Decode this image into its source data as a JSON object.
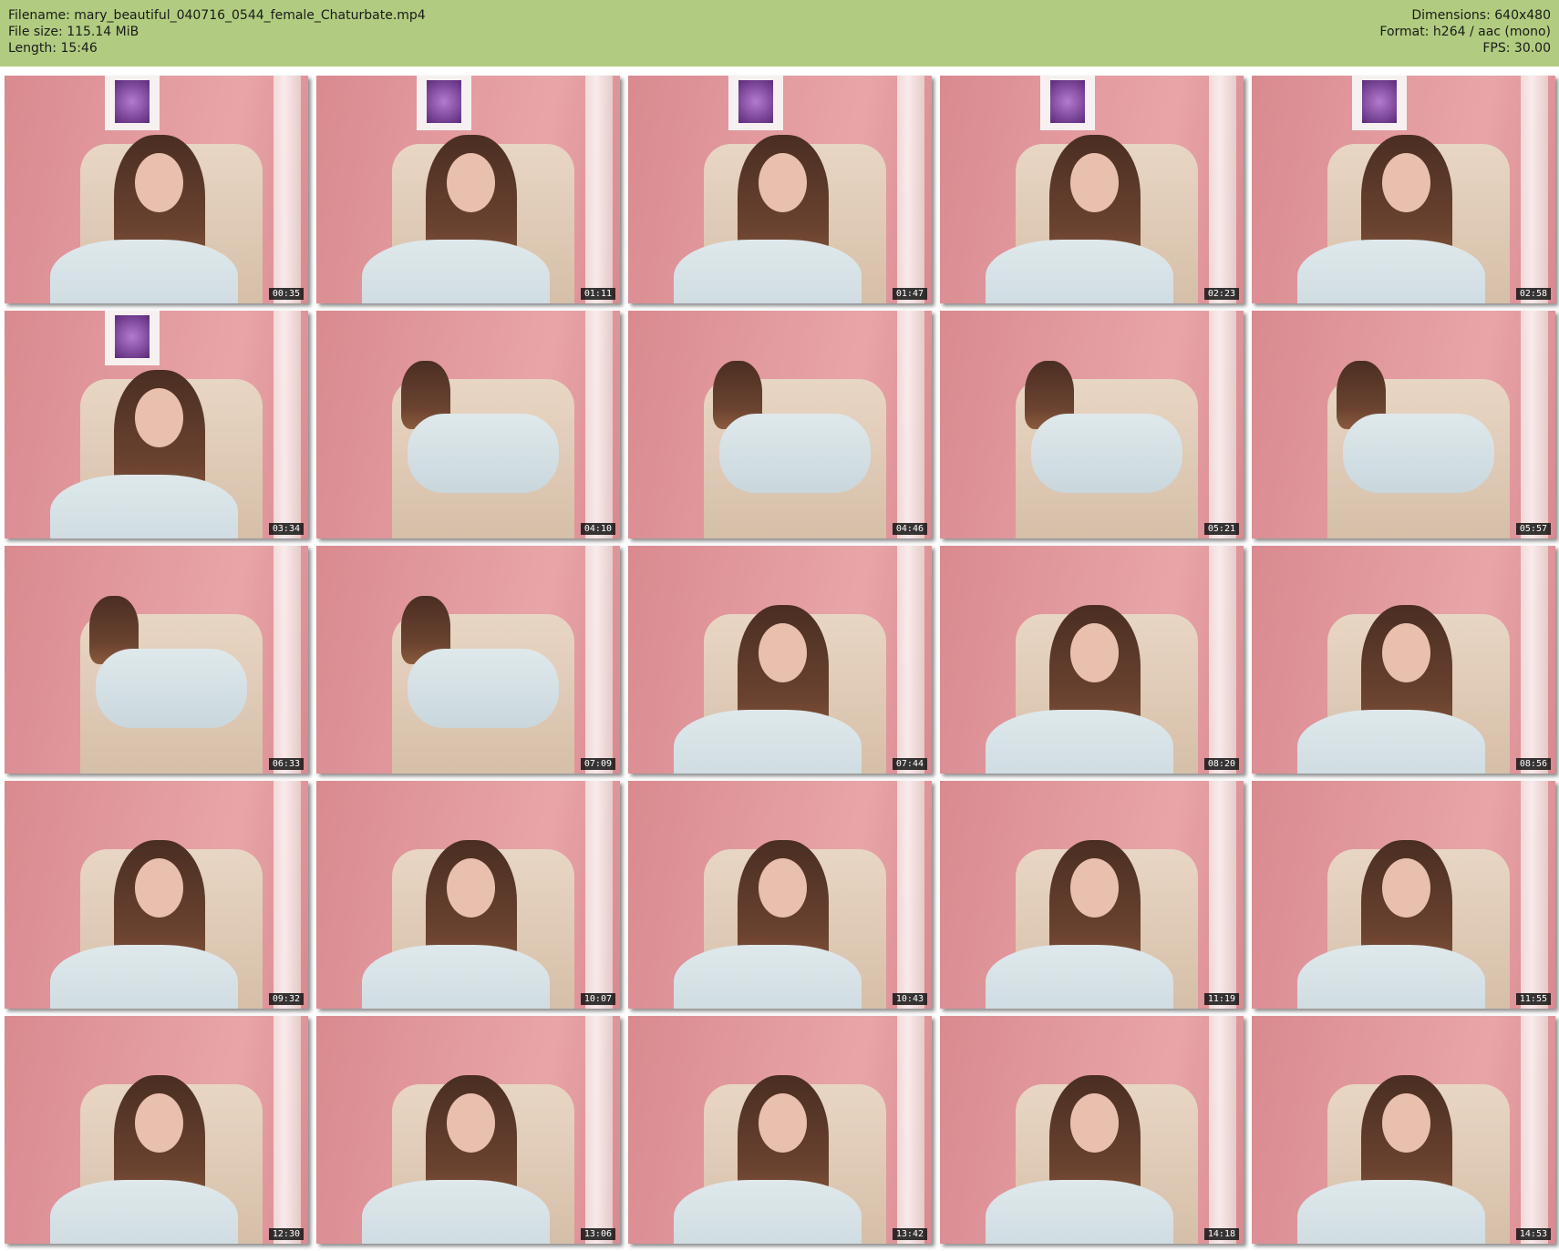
{
  "header": {
    "filename": "Filename: mary_beautiful_040716_0544_female_Chaturbate.mp4",
    "filesize": "File size: 115.14 MiB",
    "length": "Length: 15:46",
    "dimensions": "Dimensions: 640x480",
    "format": "Format: h264 / aac (mono)",
    "fps": "FPS: 30.00"
  },
  "colors": {
    "header_bg": "#b1cc80"
  },
  "thumbnails": [
    {
      "time": "00:35",
      "scene": "chair"
    },
    {
      "time": "01:11",
      "scene": "chair"
    },
    {
      "time": "01:47",
      "scene": "chair"
    },
    {
      "time": "02:23",
      "scene": "chair"
    },
    {
      "time": "02:58",
      "scene": "chair"
    },
    {
      "time": "03:34",
      "scene": "chair"
    },
    {
      "time": "04:10",
      "scene": "couch"
    },
    {
      "time": "04:46",
      "scene": "couch"
    },
    {
      "time": "05:21",
      "scene": "couch"
    },
    {
      "time": "05:57",
      "scene": "couch"
    },
    {
      "time": "06:33",
      "scene": "couch"
    },
    {
      "time": "07:09",
      "scene": "couch"
    },
    {
      "time": "07:44",
      "scene": "close"
    },
    {
      "time": "08:20",
      "scene": "close"
    },
    {
      "time": "08:56",
      "scene": "close"
    },
    {
      "time": "09:32",
      "scene": "close"
    },
    {
      "time": "10:07",
      "scene": "close"
    },
    {
      "time": "10:43",
      "scene": "close"
    },
    {
      "time": "11:19",
      "scene": "close"
    },
    {
      "time": "11:55",
      "scene": "close"
    },
    {
      "time": "12:30",
      "scene": "close"
    },
    {
      "time": "13:06",
      "scene": "close"
    },
    {
      "time": "13:42",
      "scene": "close"
    },
    {
      "time": "14:18",
      "scene": "close"
    },
    {
      "time": "14:53",
      "scene": "close"
    }
  ]
}
